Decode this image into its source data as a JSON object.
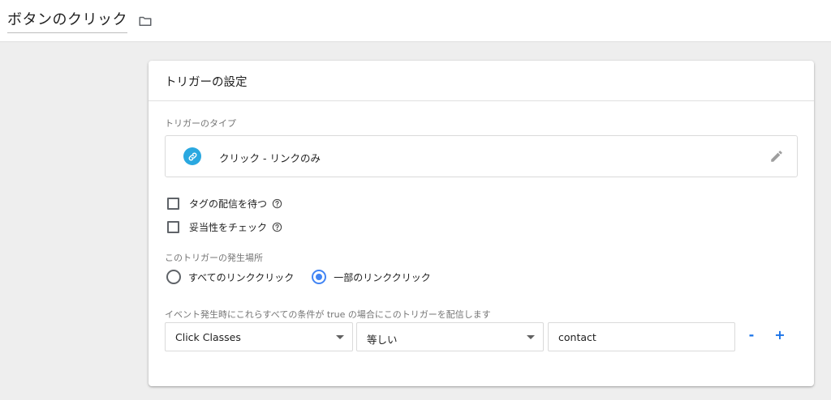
{
  "header": {
    "title": "ボタンのクリック",
    "folder_icon": "folder-icon"
  },
  "card": {
    "title": "トリガーの設定",
    "trigger_type_label": "トリガーのタイプ",
    "trigger_type": {
      "name": "クリック - リンクのみ",
      "icon": "link-icon",
      "icon_color": "#2aa8e0"
    },
    "options": [
      {
        "label": "タグの配信を待つ",
        "checked": false
      },
      {
        "label": "妥当性をチェック",
        "checked": false
      }
    ],
    "fire_on_label": "このトリガーの発生場所",
    "fire_on_options": [
      {
        "label": "すべてのリンククリック",
        "selected": false
      },
      {
        "label": "一部のリンククリック",
        "selected": true
      }
    ],
    "condition_label": "イベント発生時にこれらすべての条件が true の場合にこのトリガーを配信します",
    "condition": {
      "variable": "Click Classes",
      "operator": "等しい",
      "value": "contact",
      "remove_label": "-",
      "add_label": "+"
    }
  },
  "colors": {
    "accent": "#4285f4",
    "link_blue": "#1a73e8"
  }
}
